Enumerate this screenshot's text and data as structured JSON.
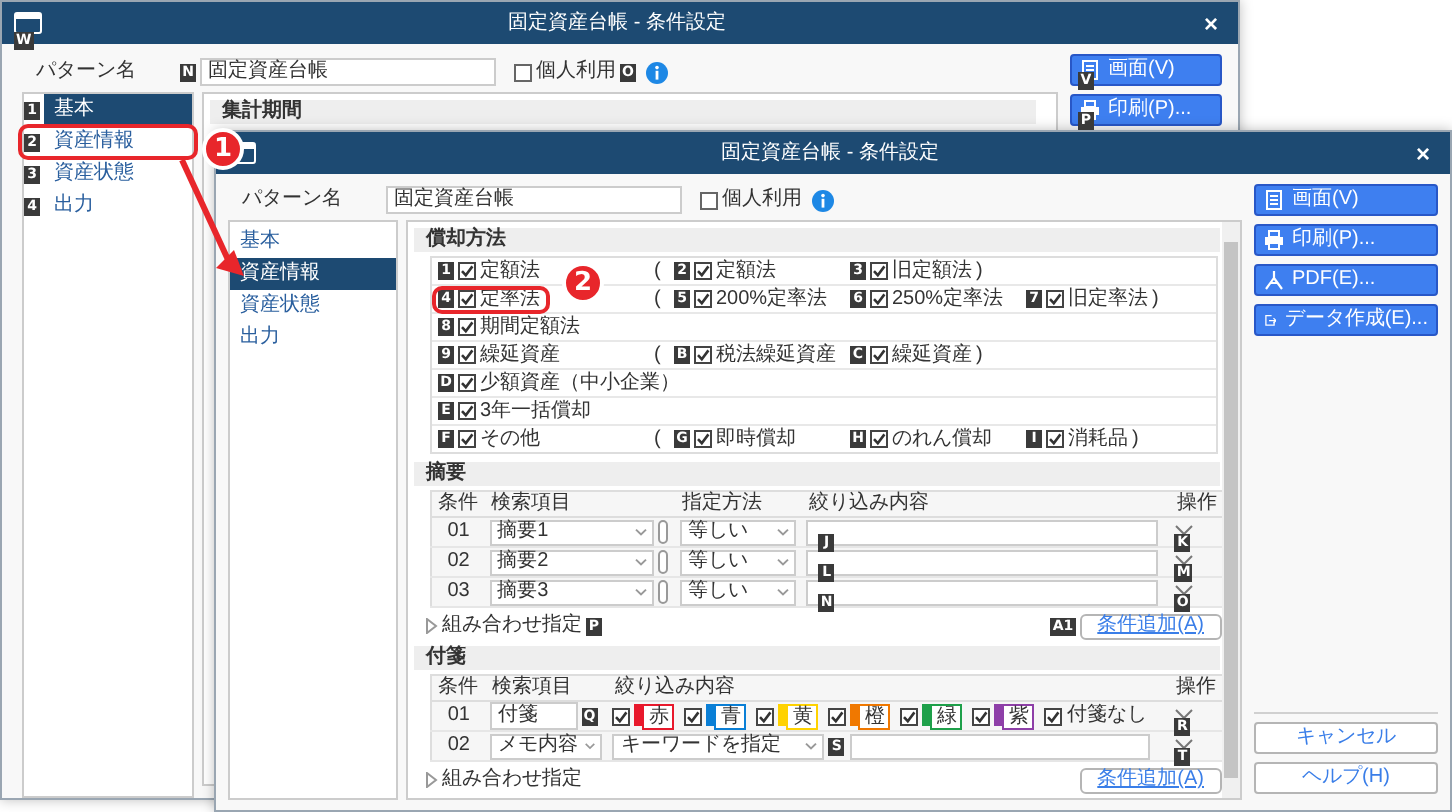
{
  "back_window": {
    "title": "固定資産台帳 - 条件設定",
    "close": "×",
    "keytip": "W",
    "pattern_label": "パターン名",
    "pattern_name": {
      "value": "固定資産台帳",
      "keytip": "N"
    },
    "personal_use": {
      "label": "個人利用",
      "checked": false,
      "keytip": "O"
    },
    "sidebar": [
      {
        "label": "基本",
        "selected": true,
        "keytip": "1"
      },
      {
        "label": "資産情報",
        "selected": false,
        "keytip": "2"
      },
      {
        "label": "資産状態",
        "selected": false,
        "keytip": "3"
      },
      {
        "label": "出力",
        "selected": false,
        "keytip": "4"
      }
    ],
    "section_title": "集計期間",
    "buttons": [
      {
        "label": "画面(V)",
        "keytip": "V"
      },
      {
        "label": "印刷(P)...",
        "keytip": "P"
      }
    ]
  },
  "front_window": {
    "title": "固定資産台帳 - 条件設定",
    "close": "×",
    "pattern_label": "パターン名",
    "pattern_name": {
      "value": "固定資産台帳"
    },
    "personal_use": {
      "label": "個人利用",
      "checked": false
    },
    "sidebar": [
      {
        "label": "基本",
        "selected": false
      },
      {
        "label": "資産情報",
        "selected": true
      },
      {
        "label": "資産状態",
        "selected": false
      },
      {
        "label": "出力",
        "selected": false
      }
    ],
    "depreciation": {
      "title": "償却方法",
      "rows": [
        {
          "label": "定額法",
          "checked": true,
          "keytip": "1",
          "paren_open": "(",
          "paren_close": ")",
          "sub": [
            {
              "label": "定額法",
              "checked": true,
              "keytip": "2"
            },
            {
              "label": "旧定額法",
              "checked": true,
              "keytip": "3"
            }
          ]
        },
        {
          "label": "定率法",
          "checked": true,
          "keytip": "4",
          "paren_open": "(",
          "paren_close": ")",
          "sub": [
            {
              "label": "200%定率法",
              "checked": true,
              "keytip": "5"
            },
            {
              "label": "250%定率法",
              "checked": true,
              "keytip": "6"
            },
            {
              "label": "旧定率法",
              "checked": true,
              "keytip": "7"
            }
          ]
        },
        {
          "label": "期間定額法",
          "checked": true,
          "keytip": "8"
        },
        {
          "label": "繰延資産",
          "checked": true,
          "keytip": "9",
          "paren_open": "(",
          "paren_close": ")",
          "sub": [
            {
              "label": "税法繰延資産",
              "checked": true,
              "keytip": "B"
            },
            {
              "label": "繰延資産",
              "checked": true,
              "keytip": "C"
            }
          ]
        },
        {
          "label": "少額資産（中小企業）",
          "checked": true,
          "keytip": "D"
        },
        {
          "label": "3年一括償却",
          "checked": true,
          "keytip": "E"
        },
        {
          "label": "その他",
          "checked": true,
          "keytip": "F",
          "paren_open": "(",
          "paren_close": ")",
          "sub": [
            {
              "label": "即時償却",
              "checked": true,
              "keytip": "G"
            },
            {
              "label": "のれん償却",
              "checked": true,
              "keytip": "H"
            },
            {
              "label": "消耗品",
              "checked": true,
              "keytip": "I"
            }
          ]
        }
      ]
    },
    "summary": {
      "title": "摘要",
      "columns": [
        "条件",
        "検索項目",
        "指定方法",
        "絞り込み内容",
        "操作"
      ],
      "rows": [
        {
          "no": "01",
          "item": "摘要1",
          "method": "等しい",
          "value_keytip": "J",
          "op_keytip": "K"
        },
        {
          "no": "02",
          "item": "摘要2",
          "method": "等しい",
          "value_keytip": "L",
          "op_keytip": "M"
        },
        {
          "no": "03",
          "item": "摘要3",
          "method": "等しい",
          "value_keytip": "N",
          "op_keytip": "O"
        }
      ],
      "combo": {
        "label": "組み合わせ指定",
        "keytip": "P"
      },
      "add": {
        "label": "条件追加(A)",
        "keytip": "A1"
      }
    },
    "sticky": {
      "title": "付箋",
      "columns": [
        "条件",
        "検索項目",
        "絞り込み内容",
        "操作"
      ],
      "rows": [
        {
          "kind": "tags",
          "no": "01",
          "item": "付箋",
          "keytip": "Q",
          "op_keytip": "R",
          "none": {
            "label": "付箋なし",
            "checked": true
          },
          "tags": [
            {
              "label": "赤",
              "color": "#e8192c",
              "checked": true
            },
            {
              "label": "青",
              "color": "#0a7fd6",
              "checked": true
            },
            {
              "label": "黄",
              "color": "#ffd200",
              "checked": true
            },
            {
              "label": "橙",
              "color": "#f07800",
              "checked": true
            },
            {
              "label": "緑",
              "color": "#1ea04a",
              "checked": true
            },
            {
              "label": "紫",
              "color": "#8e3fa8",
              "checked": true
            }
          ]
        },
        {
          "kind": "keyword",
          "no": "02",
          "item": "メモ内容",
          "method": "キーワードを指定",
          "keytip": "S",
          "op_keytip": "T"
        }
      ],
      "combo": {
        "label": "組み合わせ指定"
      },
      "add": {
        "label": "条件追加(A)"
      }
    },
    "buttons": [
      {
        "label": "画面(V)"
      },
      {
        "label": "印刷(P)..."
      },
      {
        "label": "PDF(E)..."
      },
      {
        "label": "データ作成(E)..."
      }
    ],
    "footer_buttons": [
      {
        "label": "キャンセル"
      },
      {
        "label": "ヘルプ(H)"
      }
    ]
  },
  "callouts": [
    {
      "number": "1"
    },
    {
      "number": "2"
    }
  ]
}
